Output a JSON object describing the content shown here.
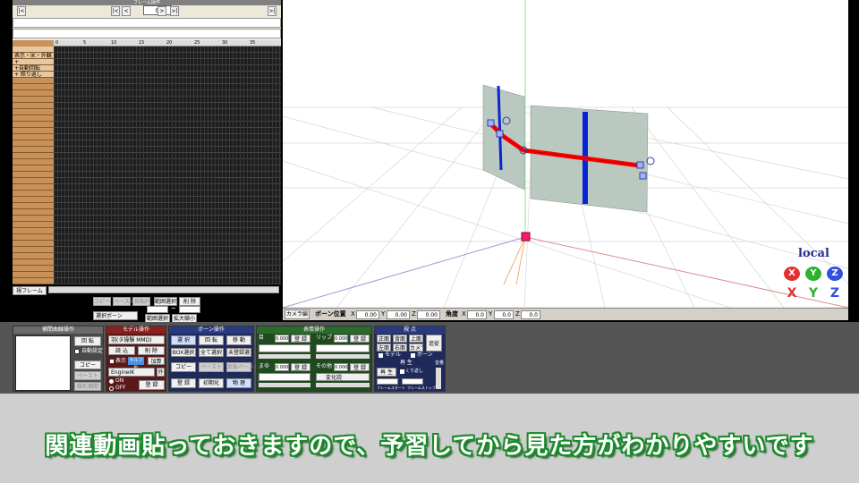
{
  "frame_panel": {
    "title": "フレーム操作",
    "frame_number": "0",
    "nav_prev_end": "|<",
    "nav_prev": "<",
    "nav_next": ">",
    "nav_next_end": ">|",
    "nav_right": ">|",
    "ruler_ticks": [
      "0",
      "5",
      "10",
      "15",
      "20",
      "25",
      "30",
      "35"
    ],
    "rows": [
      {
        "label": ""
      },
      {
        "label": "表示・IK・外観"
      },
      {
        "label": "+"
      },
      {
        "label": "+自動回転"
      },
      {
        "label": "+ 照り返し"
      }
    ],
    "view_frame_button": "視フレーム",
    "copy_button": "コピー",
    "paste_button": "ペースト",
    "reverse_paste_button": "反転P",
    "select_range_button": "範囲選択",
    "delete_button": "削 除",
    "tilde": "~",
    "select_bone_dropdown": "選択ボーン",
    "range_select_button": "範囲選択",
    "expand_button": "拡大縮小"
  },
  "viewport": {
    "local_label": "local",
    "gizmo_top": [
      "X",
      "Y",
      "Z"
    ],
    "gizmo_bottom": [
      "X",
      "Y",
      "Z"
    ]
  },
  "viewport_bar": {
    "camera_button": "カメラ編",
    "bone_pos_label": "ボーン位置",
    "x_label": "X",
    "x_value": "0.00",
    "y_label": "Y",
    "y_value": "0.00",
    "z_label": "Z",
    "z_value": "0.00",
    "angle_label": "角度",
    "ax_label": "X",
    "ax_value": "0.0",
    "ay_label": "Y",
    "ay_value": "0.0",
    "az_label": "Z",
    "az_value": "0.0"
  },
  "interp_panel": {
    "title": "補間曲線操作",
    "rotate_label": "回 転",
    "auto_label": "自動設定",
    "copy": "コピー",
    "paste": "ペースト",
    "linear": "線形補間"
  },
  "model_panel": {
    "title": "モデル操作",
    "model_select": "羽(タ操験 MMD)",
    "load": "読 込",
    "delete": "削 除",
    "display_label": "表示",
    "shadow_label": "セルフ影",
    "add": "加算",
    "engine_select": "EngineIK",
    "outside": "外",
    "on_label": "ON",
    "off_label": "OFF",
    "register": "登 録"
  },
  "bone_panel": {
    "title": "ボーン操作",
    "select": "選 択",
    "rotate": "回 転",
    "move": "移 動",
    "box_select": "BOX選択",
    "select_all": "全て選択",
    "unregistered": "未登録選",
    "copy": "コピー",
    "paste": "ペースト",
    "reverse_paste": "反転ペースト",
    "register": "登 録",
    "initialize": "初期化",
    "physics": "物 理"
  },
  "facial_panel": {
    "title": "表情操作",
    "eye_label": "目",
    "eye_value": "0.000",
    "register": "登 録",
    "lip_label": "リップ",
    "lip_value": "0.000",
    "brow_label": "まゆ",
    "brow_value": "0.000",
    "other_label": "その他",
    "other_value": "0.000",
    "other_select": "変化説"
  },
  "view_panel": {
    "title": "視 点",
    "front": "正面",
    "back": "背面",
    "top": "上面",
    "follow": "追従",
    "left": "左面",
    "right": "右面",
    "camera": "カメラ",
    "model_label": "モデル",
    "bone_label": "ボーン",
    "play_title": "再 生",
    "play": "再 生",
    "loop_label": "くり返し",
    "frame_start": "フレームスタート",
    "frame_stop": "フレームストップ",
    "volume_label": "音量"
  },
  "subtitle": "関連動画貼っておきますので、予習してから見た方がわかりやすいです"
}
